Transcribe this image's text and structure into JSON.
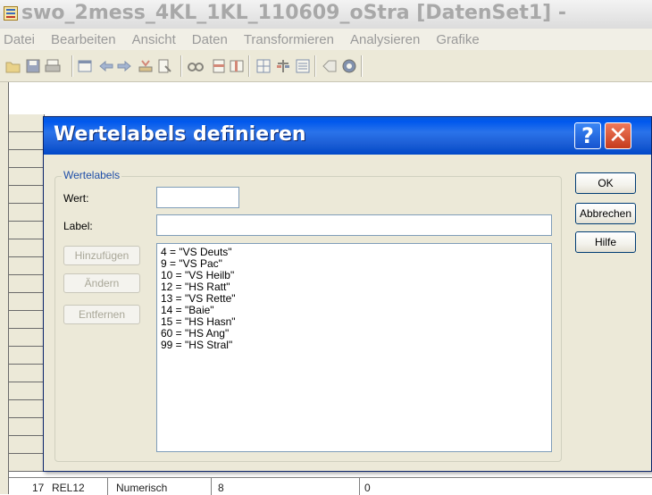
{
  "app": {
    "title": "swo_2mess_4KL_1KL_110609_oStra [DatenSet1] -"
  },
  "menubar": {
    "items": [
      "Datei",
      "Bearbeiten",
      "Ansicht",
      "Daten",
      "Transformieren",
      "Analysieren",
      "Grafike"
    ]
  },
  "toolbar": {
    "icons": [
      "open-icon",
      "save-icon",
      "print-icon",
      "dialog-recall-icon",
      "undo-icon",
      "redo-icon",
      "goto-case-icon",
      "variables-icon",
      "find-icon",
      "insert-cases-icon",
      "insert-variable-icon",
      "split-file-icon",
      "weight-cases-icon",
      "select-cases-icon",
      "value-labels-icon",
      "use-sets-icon"
    ]
  },
  "dialog": {
    "title": "Wertelabels definieren",
    "group_label": "Wertelabels",
    "wert_label": "Wert:",
    "wert_value": "",
    "label_label": "Label:",
    "label_value": "",
    "buttons": {
      "add": "Hinzufügen",
      "change": "Ändern",
      "remove": "Entfernen",
      "ok": "OK",
      "cancel": "Abbrechen",
      "help": "Hilfe"
    },
    "value_labels": [
      "4 = \"VS Deuts\"",
      "9 = \"VS Pac\"",
      "10 = \"VS Heilb\"",
      "12 = \"HS Ratt\"",
      "13 = \"VS Rette\"",
      "14 = \"Baie\"",
      "15 = \"HS Hasn\"",
      "60 = \"HS Ang\"",
      "99 = \"HS Stral\""
    ]
  },
  "grid": {
    "bottom_row": {
      "number": "17",
      "name": "REL12",
      "type": "Numerisch",
      "width": "8",
      "decimals": "0"
    }
  }
}
